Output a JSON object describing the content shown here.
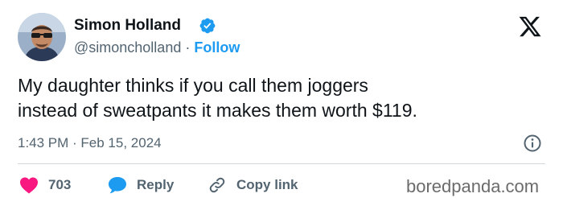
{
  "author": {
    "name": "Simon Holland",
    "handle": "@simoncholland",
    "separator": "·",
    "follow_label": "Follow",
    "verified_color": "#1d9bf0"
  },
  "tweet": {
    "text_line1": "My daughter thinks if you call them joggers",
    "text_line2": "instead of sweatpants it makes them worth $119.",
    "timestamp": "1:43 PM · Feb 15, 2024"
  },
  "actions": {
    "likes_count": "703",
    "reply_label": "Reply",
    "copy_label": "Copy link"
  },
  "icons": {
    "platform": "x-logo-icon",
    "verified": "verified-badge-icon",
    "info": "info-icon",
    "like": "heart-icon",
    "reply": "speech-bubble-icon",
    "copy": "link-icon"
  },
  "colors": {
    "like": "#f91880",
    "reply": "#1d9bf0",
    "link_text": "#1d9bf0",
    "muted": "#536471"
  },
  "watermark": "boredpanda.com"
}
